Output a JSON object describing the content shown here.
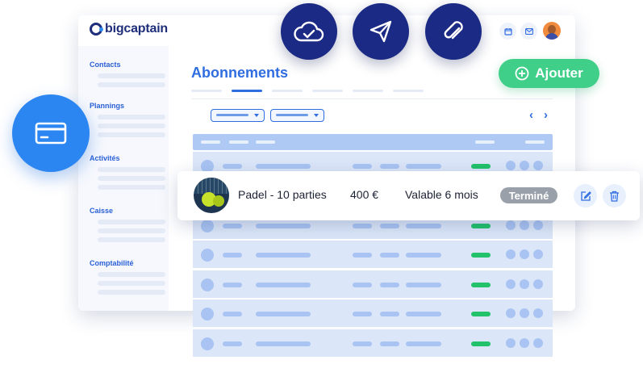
{
  "app": {
    "logo_text": "bigcaptain"
  },
  "page": {
    "title": "Abonnements"
  },
  "sidebar": {
    "sections": [
      {
        "title": "Contacts"
      },
      {
        "title": "Plannings"
      },
      {
        "title": "Activités"
      },
      {
        "title": "Caisse"
      },
      {
        "title": "Comptabilité"
      }
    ]
  },
  "actions": {
    "add_label": "Ajouter"
  },
  "icons": {
    "cloud": "cloud-check-icon",
    "send": "paper-plane-icon",
    "attach": "paperclip-icon",
    "card": "credit-card-icon",
    "calendar": "calendar-icon",
    "mail": "mail-icon",
    "edit": "edit-icon",
    "delete": "trash-icon"
  },
  "subscription": {
    "name": "Padel - 10 parties",
    "price": "400 €",
    "validity": "Valable 6 mois",
    "status": "Terminé"
  },
  "colors": {
    "brand_navy": "#1b2a84",
    "accent_blue": "#2f6de1",
    "add_green": "#3fcf88",
    "status_grey": "#9aa0aa",
    "active_green": "#22c26a"
  }
}
